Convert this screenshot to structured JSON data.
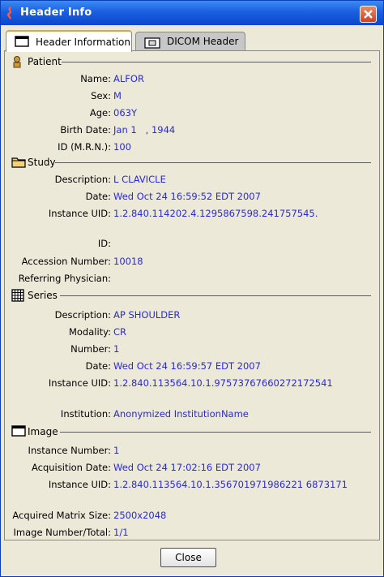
{
  "window": {
    "title": "Header Info"
  },
  "tabs": [
    {
      "label": "Header Information"
    },
    {
      "label": "DICOM Header"
    }
  ],
  "sections": {
    "patient": {
      "title": "Patient",
      "fields": [
        {
          "label": "Name:",
          "value": "ALFOR"
        },
        {
          "label": "Sex:",
          "value": "M"
        },
        {
          "label": "Age:",
          "value": "063Y"
        },
        {
          "label": "Birth Date:",
          "value": "Jan 1   , 1944"
        },
        {
          "label": "ID (M.R.N.):",
          "value": "100"
        }
      ]
    },
    "study": {
      "title": "Study",
      "fields": [
        {
          "label": "Description:",
          "value": "L CLAVICLE"
        },
        {
          "label": "Date:",
          "value": "Wed Oct 24 16:59:52 EDT 2007"
        },
        {
          "label": "Instance UID:",
          "value": "1.2.840.114202.4.1295867598.241757545."
        },
        {
          "label": "ID:",
          "value": ""
        },
        {
          "label": "Accession Number:",
          "value": "10018"
        },
        {
          "label": "Referring Physician:",
          "value": ""
        }
      ]
    },
    "series": {
      "title": "Series",
      "fields": [
        {
          "label": "Description:",
          "value": "AP SHOULDER"
        },
        {
          "label": "Modality:",
          "value": "CR"
        },
        {
          "label": "Number:",
          "value": "1"
        },
        {
          "label": "Date:",
          "value": "Wed Oct 24 16:59:57 EDT 2007"
        },
        {
          "label": "Instance UID:",
          "value": "1.2.840.113564.10.1.97573767660272172541"
        },
        {
          "label": "Institution:",
          "value": "Anonymized InstitutionName"
        }
      ]
    },
    "image": {
      "title": "Image",
      "fields": [
        {
          "label": "Instance Number:",
          "value": "1"
        },
        {
          "label": "Acquisition Date:",
          "value": "Wed Oct 24 17:02:16 EDT 2007"
        },
        {
          "label": "Instance UID:",
          "value": "1.2.840.113564.10.1.356701971986221 6873171"
        },
        {
          "label": "Acquired Matrix Size:",
          "value": "2500x2048"
        },
        {
          "label": "Image Number/Total:",
          "value": "1/1"
        }
      ]
    }
  },
  "buttons": {
    "close": "Close"
  },
  "colors": {
    "title_bar": "#1b5fe0",
    "value_text": "#2a2ad8",
    "panel_bg": "#ece9d8",
    "active_tab_accent": "#e6a23c"
  },
  "icons": {
    "app": "app-icon",
    "window_close": "close-icon",
    "tab_header_info": "window-icon",
    "tab_dicom": "dicom-icon",
    "patient": "person-icon",
    "study": "folder-icon",
    "series": "grid-icon",
    "image": "window-icon"
  }
}
